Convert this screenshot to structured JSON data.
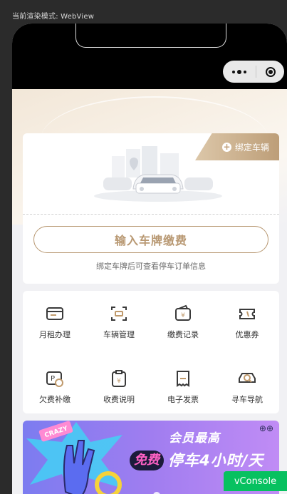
{
  "render_mode_label": "当前渲染模式: WebView",
  "capsule": {
    "more_icon": "more-dots-icon",
    "close_icon": "close-target-icon"
  },
  "bind_vehicle": {
    "label": "绑定车辆",
    "icon": "plus-circle-icon"
  },
  "plate_payment": {
    "button_label": "输入车牌缴费",
    "hint": "绑定车牌后可查看停车订单信息"
  },
  "menu": [
    {
      "label": "月租办理",
      "icon": "card-icon"
    },
    {
      "label": "车辆管理",
      "icon": "scan-frame-icon"
    },
    {
      "label": "缴费记录",
      "icon": "wallet-yuan-icon"
    },
    {
      "label": "优惠券",
      "icon": "ticket-icon"
    },
    {
      "label": "欠费补缴",
      "icon": "parking-payment-icon"
    },
    {
      "label": "收费说明",
      "icon": "clipboard-yuan-icon"
    },
    {
      "label": "电子发票",
      "icon": "invoice-icon"
    },
    {
      "label": "寻车导航",
      "icon": "car-search-icon"
    }
  ],
  "promo": {
    "badge": "CRAZY",
    "title": "会员最高",
    "free": "免费",
    "main": "停车4小时/天",
    "corner_icon": "grid-circles-icon"
  },
  "vconsole_label": "vConsole",
  "colors": {
    "accent_gold": "#b89872",
    "vconsole_green": "#07c160",
    "promo_purple": "#a07df0"
  }
}
